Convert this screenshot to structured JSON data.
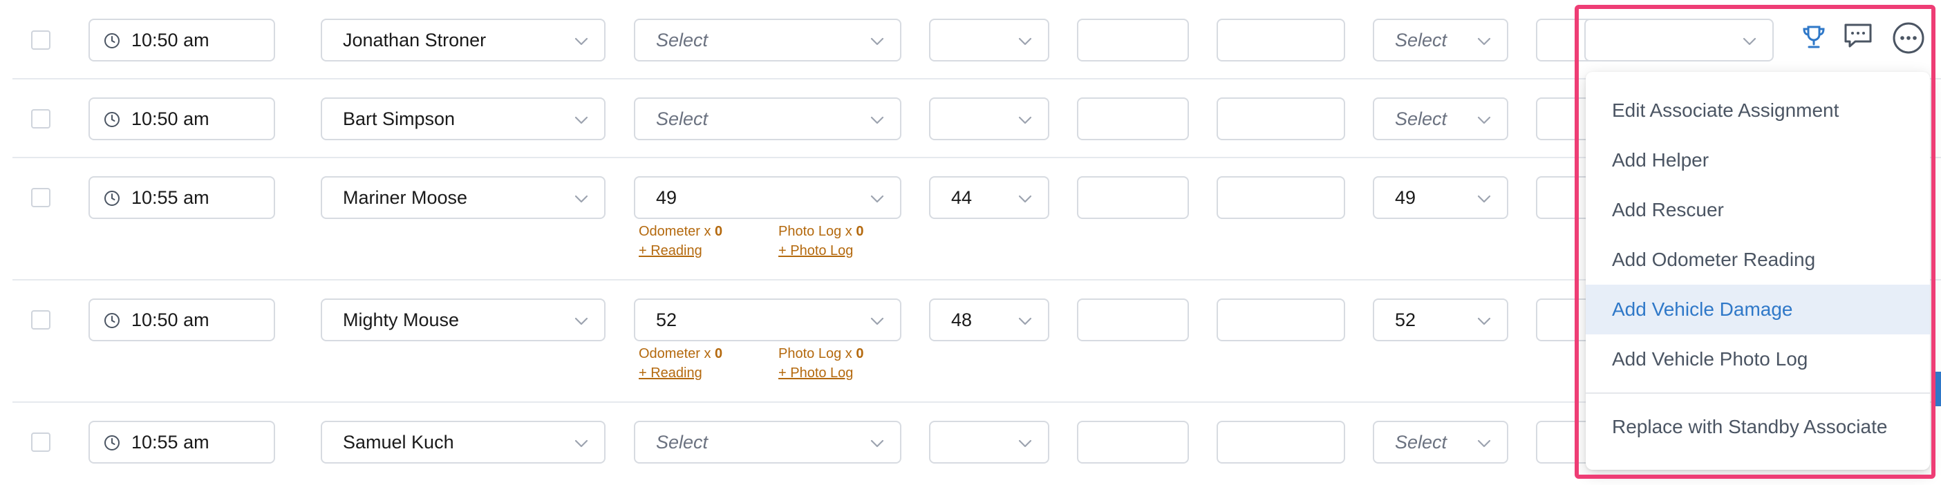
{
  "rows": [
    {
      "time": "10:50 am",
      "associate": "Jonathan Stroner",
      "route": "Select",
      "route_placeholder": true,
      "small": "",
      "box1": "",
      "box2": "",
      "select2": "Select",
      "select2_placeholder": true
    },
    {
      "time": "10:50 am",
      "associate": "Bart Simpson",
      "route": "Select",
      "route_placeholder": true,
      "small": "",
      "box1": "",
      "box2": "",
      "select2": "Select",
      "select2_placeholder": true
    },
    {
      "time": "10:55 am",
      "associate": "Mariner Moose",
      "route": "49",
      "route_placeholder": false,
      "small": "44",
      "box1": "",
      "box2": "",
      "select2": "49",
      "select2_placeholder": false,
      "odometer_label": "Odometer x",
      "odometer_count": "0",
      "reading_link": "+ Reading",
      "photolog_label": "Photo Log x",
      "photolog_count": "0",
      "photolog_link": "+ Photo Log"
    },
    {
      "time": "10:50 am",
      "associate": "Mighty Mouse",
      "route": "52",
      "route_placeholder": false,
      "small": "48",
      "box1": "",
      "box2": "",
      "select2": "52",
      "select2_placeholder": false,
      "odometer_label": "Odometer x",
      "odometer_count": "0",
      "reading_link": "+ Reading",
      "photolog_label": "Photo Log x",
      "photolog_count": "0",
      "photolog_link": "+ Photo Log"
    },
    {
      "time": "10:55 am",
      "associate": "Samuel Kuch",
      "route": "Select",
      "route_placeholder": true,
      "small": "",
      "box1": "",
      "box2": "",
      "select2": "Select",
      "select2_placeholder": true
    }
  ],
  "toolbar": {
    "icons": [
      "trophy-icon",
      "comment-icon",
      "more-options-icon"
    ]
  },
  "menu": {
    "items": [
      "Edit Associate Assignment",
      "Add Helper",
      "Add Rescuer",
      "Add Odometer Reading",
      "Add Vehicle Damage",
      "Add Vehicle Photo Log"
    ],
    "active_item": "Add Vehicle Damage",
    "footer_item": "Replace with Standby Associate"
  },
  "colors": {
    "highlight_outline": "#ee3d75",
    "link_blue": "#2f78c8",
    "meta_orange": "#b4690e"
  }
}
